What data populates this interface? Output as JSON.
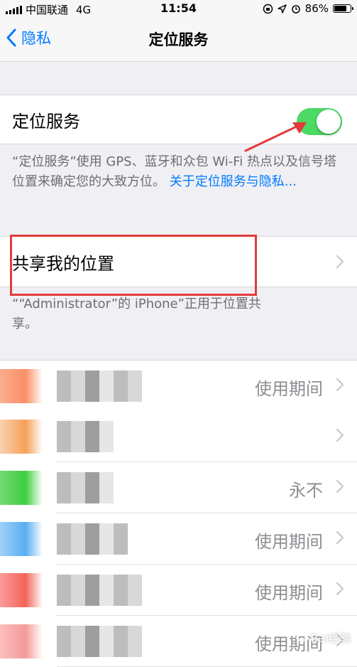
{
  "status_bar": {
    "carrier": "中国联通",
    "network": "4G",
    "time": "11:54",
    "battery_percent": "86%",
    "battery_level": 0.86
  },
  "nav": {
    "back_label": "隐私",
    "title": "定位服务"
  },
  "location_services": {
    "label": "定位服务",
    "toggle_on": true,
    "description": "“定位服务”使用 GPS、蓝牙和众包 Wi-Fi 热点以及信号塔位置来确定您的大致方位。",
    "link_text": "关于定位服务与隐私..."
  },
  "share_location": {
    "label": "共享我的位置",
    "footer": "““Administrator”的 iPhone”正用于位置共享。"
  },
  "apps": [
    {
      "status": "使用期间",
      "icon_colors": [
        "#f7a07d",
        "#fb7b4a"
      ]
    },
    {
      "status": "",
      "icon_colors": [
        "#f8c9a3",
        "#f3913b"
      ]
    },
    {
      "status": "永不",
      "icon_colors": [
        "#5ad45a",
        "#1ec51e"
      ]
    },
    {
      "status": "使用期间",
      "icon_colors": [
        "#8fc9f7",
        "#3aa0f0"
      ]
    },
    {
      "status": "使用期间",
      "icon_colors": [
        "#fb8a8a",
        "#f04a3a"
      ]
    },
    {
      "status": "使用期间",
      "icon_colors": [
        "#fbb3b3",
        "#f38888"
      ]
    }
  ],
  "colors": {
    "accent": "#007aff",
    "toggle_on": "#4cd964",
    "annotation": "#e33b3b"
  },
  "watermark": "Bai经验"
}
